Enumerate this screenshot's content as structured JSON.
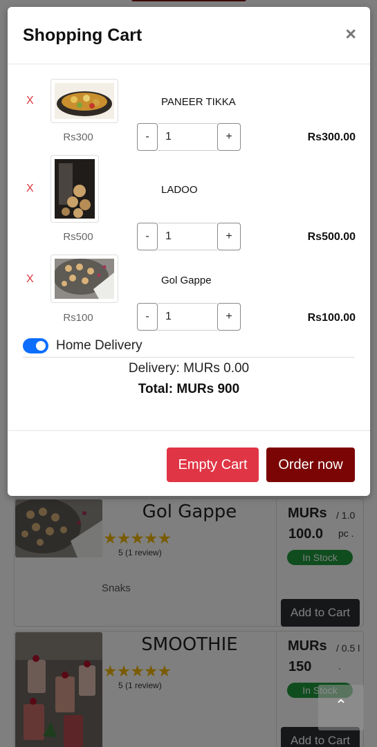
{
  "modal": {
    "title": "Shopping Cart",
    "close_label": "×",
    "items": [
      {
        "remove_label": "X",
        "name": "PANEER TIKKA",
        "unit_price": "Rs300",
        "qty_minus": "-",
        "quantity": "1",
        "qty_plus": "+",
        "line_total": "Rs300.00",
        "image": "paneer-tikka-image"
      },
      {
        "remove_label": "X",
        "name": "LADOO",
        "unit_price": "Rs500",
        "qty_minus": "-",
        "quantity": "1",
        "qty_plus": "+",
        "line_total": "Rs500.00",
        "image": "ladoo-image"
      },
      {
        "remove_label": "X",
        "name": "Gol Gappe",
        "unit_price": "Rs100",
        "qty_minus": "-",
        "quantity": "1",
        "qty_plus": "+",
        "line_total": "Rs100.00",
        "image": "gol-gappe-image"
      }
    ],
    "home_delivery_label": "Home Delivery",
    "home_delivery_on": true,
    "delivery_text": "Delivery: MURs 0.00",
    "total_text": "Total: MURs 900",
    "empty_cart_label": "Empty Cart",
    "order_now_label": "Order now"
  },
  "background_products": [
    {
      "name": "Gol Gappe",
      "stars": "★★★★★",
      "reviews": "5 (1 review)",
      "category": "Snaks",
      "currency": "MURs",
      "per": "/ 1.0",
      "amount": "100.0",
      "unit": "pc .",
      "stock": "In Stock",
      "add_label": "Add to Cart"
    },
    {
      "name": "SMOOTHIE",
      "stars": "★★★★★",
      "reviews": "5 (1 review)",
      "currency": "MURs",
      "per": "/ 0.5 l",
      "amount": "150",
      "unit": ".",
      "stock": "In Stock",
      "add_label": "Add to Cart"
    }
  ],
  "scroll_top_icon": "chevron-up-icon",
  "scroll_top_glyph": "⌃",
  "colors": {
    "empty_cart": "#e03545",
    "order_now": "#7b0505",
    "toggle": "#0d6efd",
    "remove": "#d9363e",
    "in_stock": "#1e9a3d"
  }
}
